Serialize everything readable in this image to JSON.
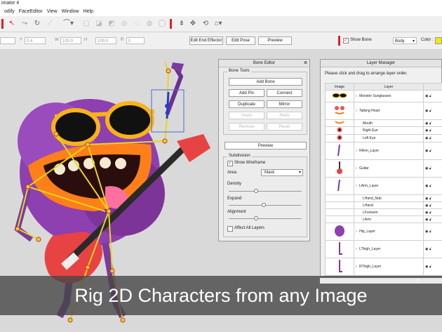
{
  "window": {
    "title": "imator 4"
  },
  "menu": [
    "odify",
    "FaceEditor",
    "View",
    "Window",
    "Help"
  ],
  "toolbar": {
    "icons": [
      "pointer-icon",
      "bone-select-icon",
      "rotate-icon",
      "bone-icon",
      "dropdown-tool-icon",
      "transform-icon",
      "move-icon",
      "rotate-tool-icon",
      "home-icon"
    ]
  },
  "props": {
    "fields": [
      {
        "label": "Y",
        "value": "0.4"
      },
      {
        "label": "W",
        "value": "100.0"
      },
      {
        "label": "H",
        "value": "100.0"
      },
      {
        "label": "R",
        "value": "0"
      }
    ],
    "edit_end_effector": "Edit End Effector",
    "edit_pose": "Edit Pose",
    "preview": "Preview",
    "show_bone": "Show Bone",
    "body_select": "Body",
    "color_label": "Color :"
  },
  "bone_editor": {
    "title": "Bone Editor",
    "tools_label": "Bone Tools",
    "add_bone": "Add Bone",
    "add_pin": "Add Pin",
    "connect": "Connect",
    "duplicate": "Duplicate",
    "mirror": "Mirror",
    "insert": "Insert",
    "redo": "Redo",
    "remove": "Remove",
    "reset": "Reset",
    "preview": "Preview",
    "subdivision_label": "Subdivision",
    "show_wireframe": "Show Wireframe",
    "area_label": "Area:",
    "area_value": "Mask",
    "density": "Density",
    "density_level": 0.35,
    "expand": "Expand",
    "expand_level": 0.45,
    "alignment": "Alignment",
    "alignment_level": 0.35,
    "affect_all": "Affect All Layers"
  },
  "layer_manager": {
    "title": "Layer Manager",
    "hint": "Please click and drag to arrange layer order.",
    "col_image": "Image",
    "col_layer": "Layer",
    "rows": [
      {
        "name": "Monster Sunglasses",
        "thumb": "sunglasses"
      },
      {
        "name": "Talking Head",
        "thumb": "face"
      },
      {
        "name": "Mouth",
        "thumb": "mouth"
      },
      {
        "name": "Right Eye",
        "thumb": "eye"
      },
      {
        "name": "Left Eye",
        "thumb": "eye"
      },
      {
        "name": "RArm_Layer",
        "thumb": "arm"
      },
      {
        "name": "Guitar",
        "thumb": "guitar"
      },
      {
        "name": "LArm_Layer",
        "thumb": "arm"
      },
      {
        "name": "LHand_Nub",
        "thumb": ""
      },
      {
        "name": "LHand",
        "thumb": ""
      },
      {
        "name": "LForearm",
        "thumb": ""
      },
      {
        "name": "LArm",
        "thumb": ""
      },
      {
        "name": "Hip_Layer",
        "thumb": "hip"
      },
      {
        "name": "LThigh_Layer",
        "thumb": "leg"
      },
      {
        "name": "RThigh_Layer",
        "thumb": "leg"
      }
    ],
    "add_symbol": "+"
  },
  "banner": {
    "text": "Rig 2D Characters from any Image"
  },
  "colors": {
    "monster": "#8e3fb0",
    "bone": "#e8d51a",
    "accent": "#e02020",
    "sunglasses": "#f7b318",
    "mouth": "#ff7f1a"
  }
}
